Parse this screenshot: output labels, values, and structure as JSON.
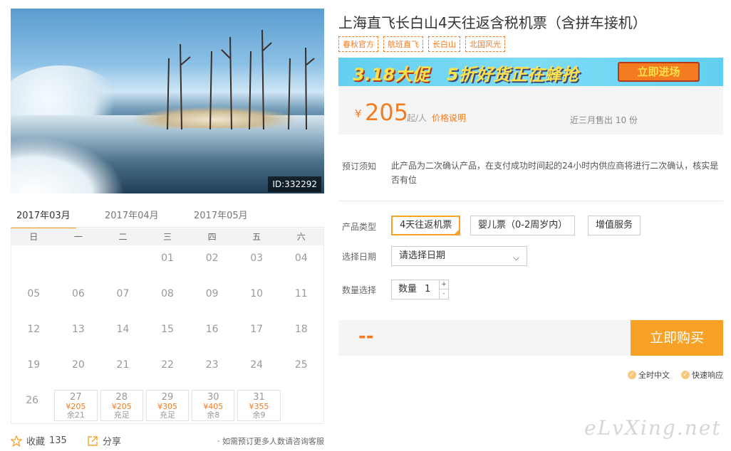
{
  "product": {
    "title": "上海直飞长白山4天往返含税机票（含拼车接机）",
    "tags": [
      "春秋官方",
      "航班直飞",
      "长白山",
      "北国风光"
    ],
    "image_id": "ID:332292"
  },
  "banner": {
    "promo": "3.18大促",
    "slogan": "5折好货正在蜂抢",
    "cta": "立即进场"
  },
  "price": {
    "currency": "¥",
    "amount": "205",
    "per": "起/人",
    "explain_link": "价格说明",
    "sold": "近三月售出 10 份"
  },
  "notice": {
    "label": "预订须知",
    "text": "此产品为二次确认产品，在支付成功时间起的24小时内供应商将进行二次确认，核实是否有位"
  },
  "options": {
    "type_label": "产品类型",
    "types": [
      "4天往返机票",
      "婴儿票（0-2周岁内）",
      "增值服务"
    ],
    "date_label": "选择日期",
    "date_placeholder": "请选择日期",
    "qty_label": "数量选择",
    "qty_text": "数量",
    "qty_value": "1",
    "qty_up": "+",
    "qty_down": "-"
  },
  "purchase": {
    "total": "--",
    "buy_label": "立即购买"
  },
  "guarantees": [
    "全时中文",
    "快速响应"
  ],
  "calendar": {
    "months": [
      "2017年03月",
      "2017年04月",
      "2017年05月"
    ],
    "weekdays": [
      "日",
      "一",
      "二",
      "三",
      "四",
      "五",
      "六"
    ],
    "rows": [
      [
        "",
        "",
        "",
        "01",
        "02",
        "03",
        "04"
      ],
      [
        "05",
        "06",
        "07",
        "08",
        "09",
        "10",
        "11"
      ],
      [
        "12",
        "13",
        "14",
        "15",
        "16",
        "17",
        "18"
      ],
      [
        "19",
        "20",
        "21",
        "22",
        "23",
        "24",
        "25"
      ]
    ],
    "last_row_first": "26",
    "available": [
      {
        "day": "27",
        "price": "¥205",
        "stock": "余21"
      },
      {
        "day": "28",
        "price": "¥205",
        "stock": "充足"
      },
      {
        "day": "29",
        "price": "¥305",
        "stock": "充足"
      },
      {
        "day": "30",
        "price": "¥405",
        "stock": "余8"
      },
      {
        "day": "31",
        "price": "¥355",
        "stock": "余9"
      }
    ]
  },
  "footer": {
    "favorite_label": "收藏",
    "favorite_count": "135",
    "share_label": "分享",
    "note": "· 如需预订更多人数请咨询客服"
  },
  "watermark": "eLvXing.net",
  "colors": {
    "accent": "#f47c20",
    "button": "#f7a227"
  }
}
